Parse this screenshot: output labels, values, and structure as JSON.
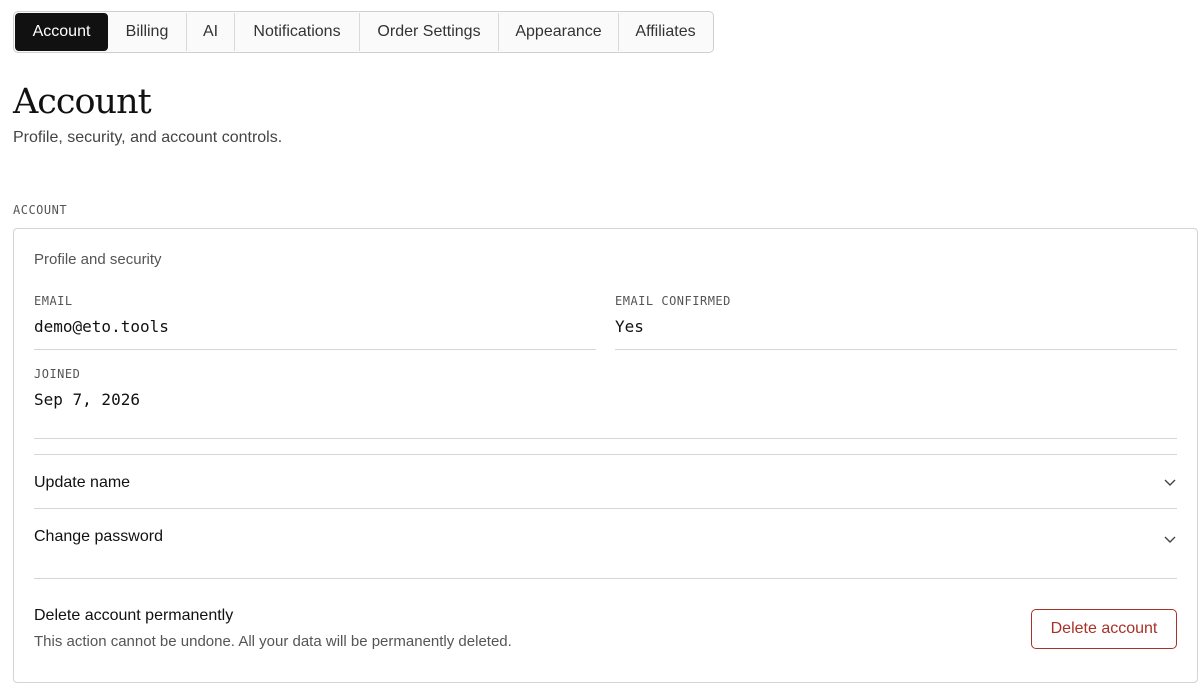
{
  "tabs": [
    {
      "label": "Account",
      "active": true
    },
    {
      "label": "Billing",
      "active": false
    },
    {
      "label": "AI",
      "active": false
    },
    {
      "label": "Notifications",
      "active": false
    },
    {
      "label": "Order Settings",
      "active": false
    },
    {
      "label": "Appearance",
      "active": false
    },
    {
      "label": "Affiliates",
      "active": false
    }
  ],
  "header": {
    "title": "Account",
    "subtitle": "Profile, security, and account controls."
  },
  "section": {
    "label": "ACCOUNT"
  },
  "card": {
    "heading": "Profile and security",
    "fields": {
      "email": {
        "label": "EMAIL",
        "value": "demo@eto.tools"
      },
      "email_confirmed": {
        "label": "EMAIL CONFIRMED",
        "value": "Yes"
      },
      "joined": {
        "label": "JOINED",
        "value": "Sep 7, 2026"
      }
    },
    "accordions": {
      "update_name": {
        "label": "Update name",
        "icon": "chevron-down-icon"
      },
      "change_password": {
        "label": "Change password",
        "icon": "chevron-down-icon"
      }
    },
    "danger": {
      "title": "Delete account permanently",
      "description": "This action cannot be undone. All your data will be permanently deleted.",
      "button_label": "Delete account"
    }
  },
  "colors": {
    "active_tab_bg": "#111111",
    "danger": "#a8322a",
    "border": "#d4d4d4"
  }
}
